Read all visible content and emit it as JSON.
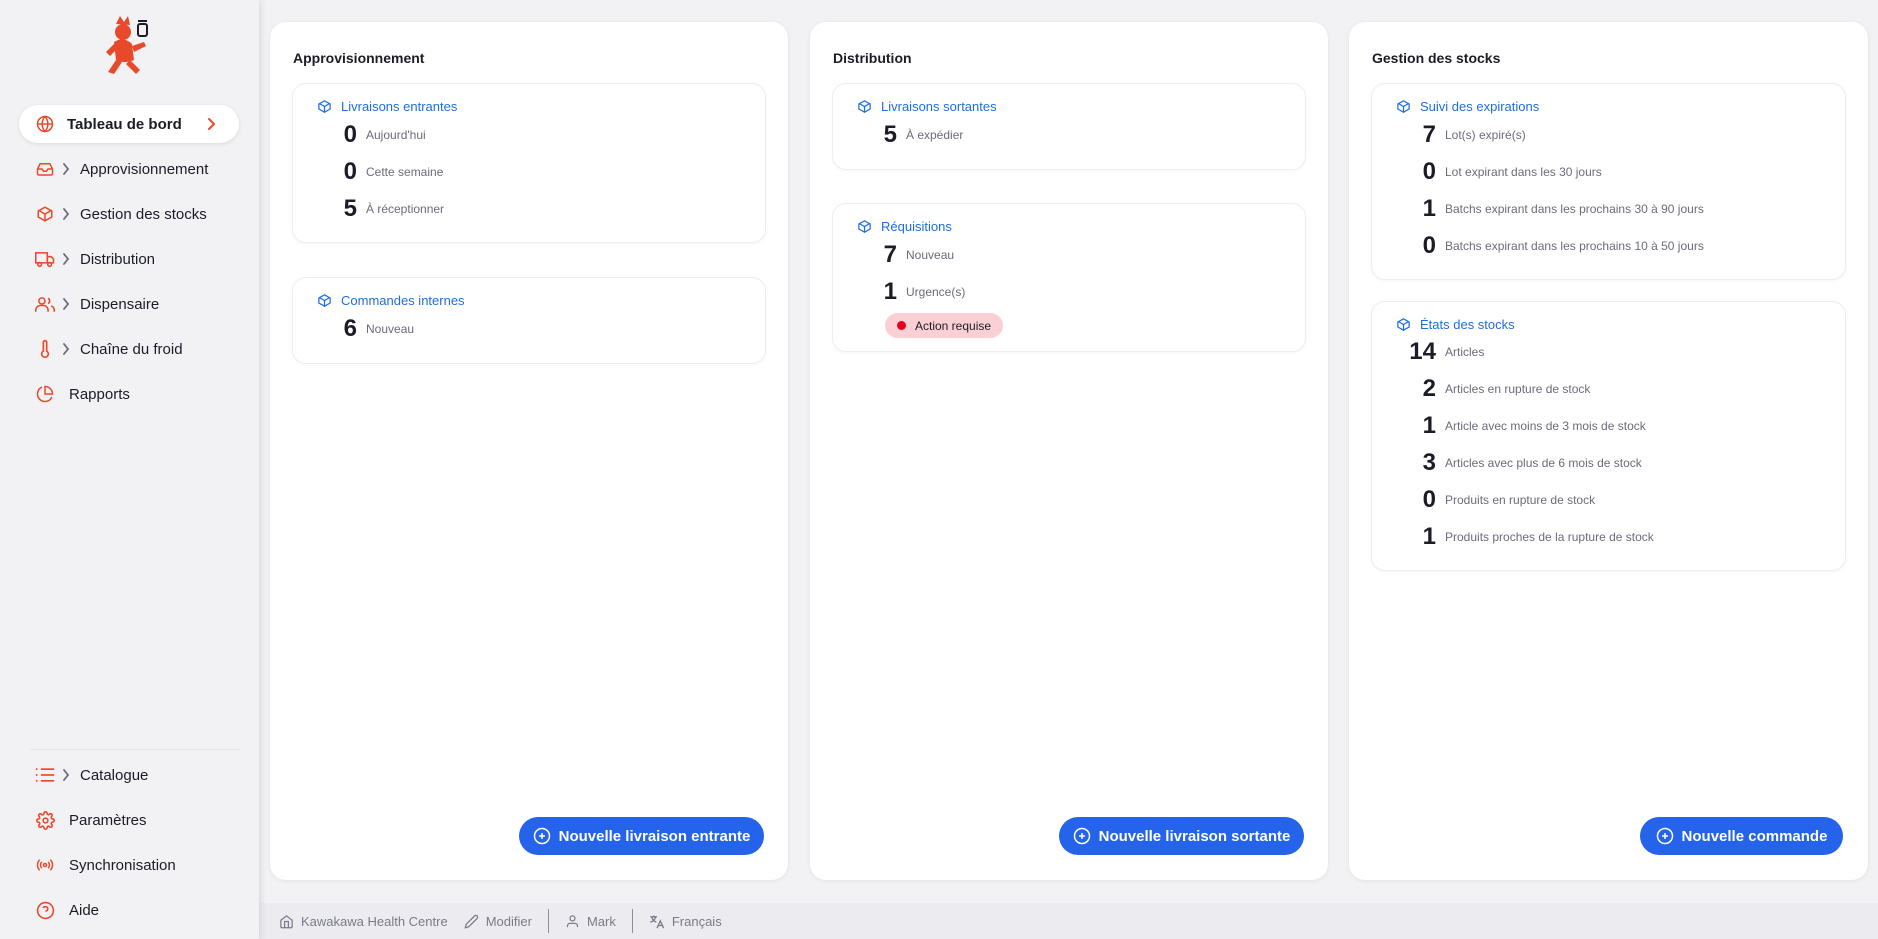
{
  "sidebar": {
    "primary": [
      {
        "label": "Tableau de bord",
        "icon": "globe-icon",
        "active": true
      },
      {
        "label": "Approvisionnement",
        "icon": "inbox-icon"
      },
      {
        "label": "Gestion des stocks",
        "icon": "box-icon"
      },
      {
        "label": "Distribution",
        "icon": "truck-icon"
      },
      {
        "label": "Dispensaire",
        "icon": "users-icon"
      },
      {
        "label": "Chaîne du froid",
        "icon": "thermometer-icon"
      },
      {
        "label": "Rapports",
        "icon": "pie-chart-icon"
      }
    ],
    "secondary": [
      {
        "label": "Catalogue",
        "icon": "list-icon"
      },
      {
        "label": "Paramètres",
        "icon": "gear-icon"
      },
      {
        "label": "Synchronisation",
        "icon": "radio-icon"
      },
      {
        "label": "Aide",
        "icon": "help-icon"
      }
    ]
  },
  "columns": {
    "replenishment": {
      "title": "Approvisionnement",
      "widgets": [
        {
          "title": "Livraisons entrantes",
          "stats": [
            {
              "value": "0",
              "label": "Aujourd'hui"
            },
            {
              "value": "0",
              "label": "Cette semaine"
            },
            {
              "value": "5",
              "label": "À réceptionner"
            }
          ]
        },
        {
          "title": "Commandes internes",
          "stats": [
            {
              "value": "6",
              "label": "Nouveau"
            }
          ]
        }
      ],
      "button": "Nouvelle livraison entrante"
    },
    "distribution": {
      "title": "Distribution",
      "widgets": [
        {
          "title": "Livraisons sortantes",
          "stats": [
            {
              "value": "5",
              "label": "À expédier"
            }
          ]
        },
        {
          "title": "Réquisitions",
          "stats": [
            {
              "value": "7",
              "label": "Nouveau"
            },
            {
              "value": "1",
              "label": "Urgence(s)"
            }
          ],
          "badge": "Action requise"
        }
      ],
      "button": "Nouvelle livraison sortante"
    },
    "inventory": {
      "title": "Gestion des stocks",
      "widgets": [
        {
          "title": "Suivi des expirations",
          "stats": [
            {
              "value": "7",
              "label": "Lot(s) expiré(s)"
            },
            {
              "value": "0",
              "label": "Lot expirant dans les 30 jours"
            },
            {
              "value": "1",
              "label": "Batchs expirant dans les prochains 30 à 90 jours"
            },
            {
              "value": "0",
              "label": "Batchs expirant dans les prochains 10 à 50 jours"
            }
          ]
        },
        {
          "title": "États des stocks",
          "stats": [
            {
              "value": "14",
              "label": "Articles"
            },
            {
              "value": "2",
              "label": "Articles en rupture de stock"
            },
            {
              "value": "1",
              "label": "Article avec moins de 3 mois de stock"
            },
            {
              "value": "3",
              "label": "Articles avec plus de 6 mois de stock"
            },
            {
              "value": "0",
              "label": "Produits en rupture de stock"
            },
            {
              "value": "1",
              "label": "Produits proches de la rupture de stock"
            }
          ]
        }
      ],
      "button": "Nouvelle commande"
    }
  },
  "footer": {
    "store": "Kawakawa Health Centre",
    "edit": "Modifier",
    "user": "Mark",
    "language": "Français"
  },
  "colors": {
    "accent_orange": "#e8492a",
    "primary_blue": "#2563eb",
    "link_blue": "#1f6ee0",
    "urgent_red": "#e8001c"
  }
}
